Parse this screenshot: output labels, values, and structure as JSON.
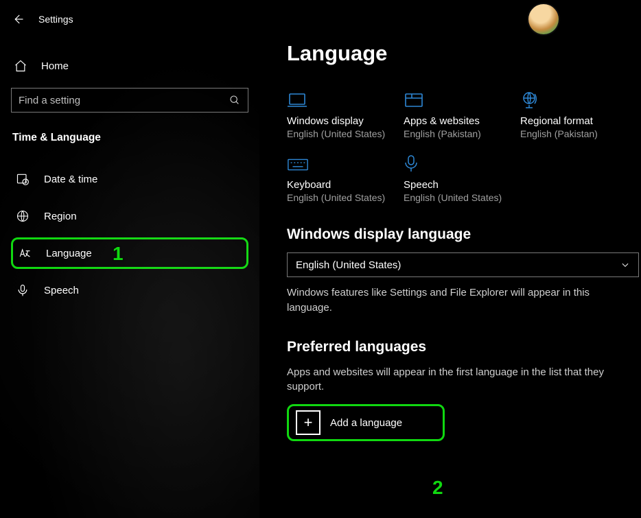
{
  "header": {
    "title": "Settings"
  },
  "sidebar": {
    "home_label": "Home",
    "search_placeholder": "Find a setting",
    "category_label": "Time & Language",
    "items": [
      {
        "label": "Date & time",
        "icon": "calendar-clock-icon"
      },
      {
        "label": "Region",
        "icon": "globe-icon"
      },
      {
        "label": "Language",
        "icon": "language-letter-icon",
        "selected": true
      },
      {
        "label": "Speech",
        "icon": "microphone-icon"
      }
    ]
  },
  "main": {
    "title": "Language",
    "tiles": [
      {
        "label": "Windows display",
        "sub": "English (United States)",
        "icon": "laptop-icon"
      },
      {
        "label": "Apps & websites",
        "sub": "English (Pakistan)",
        "icon": "window-icon"
      },
      {
        "label": "Regional format",
        "sub": "English (Pakistan)",
        "icon": "globe-stand-icon"
      },
      {
        "label": "Keyboard",
        "sub": "English (United States)",
        "icon": "keyboard-icon"
      },
      {
        "label": "Speech",
        "sub": "English (United States)",
        "icon": "microphone-icon"
      }
    ],
    "display_language": {
      "heading": "Windows display language",
      "selected": "English (United States)",
      "help": "Windows features like Settings and File Explorer will appear in this language."
    },
    "preferred": {
      "heading": "Preferred languages",
      "help": "Apps and websites will appear in the first language in the list that they support.",
      "add_label": "Add a language"
    }
  },
  "annotations": {
    "one": "1",
    "two": "2"
  }
}
